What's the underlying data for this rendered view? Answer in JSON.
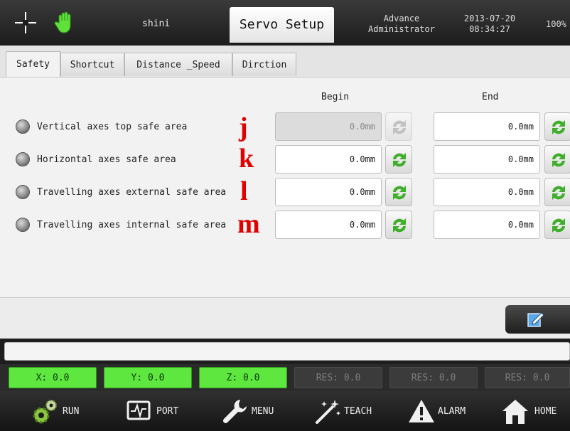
{
  "header": {
    "user": "shini",
    "title": "Servo Setup",
    "level_line1": "Advance",
    "level_line2": "Administrator",
    "date": "2013-07-20",
    "time": "08:34:27",
    "percent": "100%"
  },
  "tabs": [
    {
      "label": "Safety"
    },
    {
      "label": "Shortcut"
    },
    {
      "label": "Distance _Speed"
    },
    {
      "label": "Dirction"
    }
  ],
  "columns": {
    "begin": "Begin",
    "end": "End"
  },
  "rows": [
    {
      "label": "Vertical axes top safe area",
      "letter": "j",
      "begin": "0.0mm",
      "end": "0.0mm"
    },
    {
      "label": "Horizontal axes safe area",
      "letter": "k",
      "begin": "0.0mm",
      "end": "0.0mm"
    },
    {
      "label": "Travelling axes external safe area",
      "letter": "l",
      "begin": "0.0mm",
      "end": "0.0mm"
    },
    {
      "label": "Travelling axes internal safe area",
      "letter": "m",
      "begin": "0.0mm",
      "end": "0.0mm"
    }
  ],
  "coords": [
    {
      "label": "X: 0.0"
    },
    {
      "label": "Y: 0.0"
    },
    {
      "label": "Z: 0.0"
    },
    {
      "label": "RES: 0.0"
    },
    {
      "label": "RES: 0.0"
    },
    {
      "label": "RES: 0.0"
    }
  ],
  "nav": [
    {
      "label": "RUN",
      "icon": "gears-icon"
    },
    {
      "label": "PORT",
      "icon": "monitor-icon"
    },
    {
      "label": "MENU",
      "icon": "wrench-icon"
    },
    {
      "label": "TEACH",
      "icon": "magic-wand-icon"
    },
    {
      "label": "ALARM",
      "icon": "warning-icon"
    },
    {
      "label": "HOME",
      "icon": "home-icon"
    }
  ],
  "colors": {
    "accent_green": "#5ee83f",
    "letter_red": "#e00000",
    "refresh_green": "#3fae2a"
  }
}
